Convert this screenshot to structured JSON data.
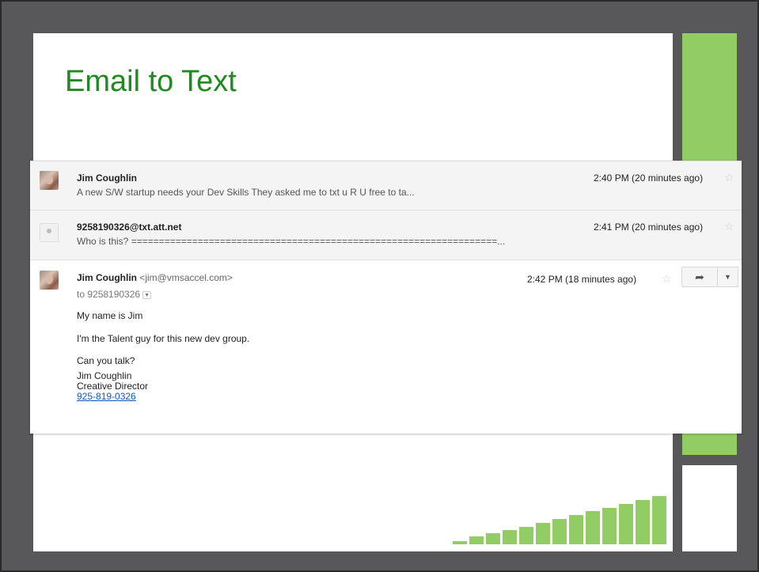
{
  "slide": {
    "title": "Email to Text",
    "accent_color": "#92cc65",
    "title_color": "#1f8a1f",
    "background_color": "#58585a"
  },
  "inbox": {
    "rows": [
      {
        "sender": "Jim Coughlin",
        "snippet": "A new S/W startup needs your Dev Skills They asked me to txt u R U free to ta...",
        "time": "2:40 PM (20 minutes ago)",
        "avatar": "profile-photo"
      },
      {
        "sender": "9258190326@txt.att.net",
        "snippet": "Who is this? ==================================================================...",
        "time": "2:41 PM (20 minutes ago)",
        "avatar": "default-person-icon"
      }
    ],
    "opened": {
      "sender": "Jim Coughlin",
      "sender_email": "<jim@vmsaccel.com>",
      "to": "to 9258190326",
      "time": "2:42 PM (18 minutes ago)",
      "body": [
        "My name is Jim",
        "I'm the Talent guy for this new dev group.",
        "Can you talk?"
      ],
      "signature": {
        "name": "Jim Coughlin",
        "role": "Creative Director",
        "phone": "925-819-0326"
      },
      "reply_icon": "reply-arrow-icon",
      "more_icon": "chevron-down-icon"
    }
  },
  "decor_bars": [
    4,
    10,
    14,
    18,
    22,
    27,
    32,
    37,
    42,
    46,
    51,
    56,
    61
  ]
}
